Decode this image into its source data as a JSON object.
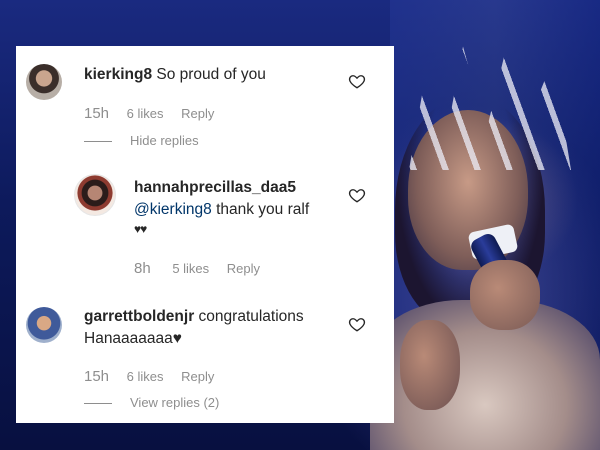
{
  "comments": [
    {
      "username": "kierking8",
      "text": "So proud of you",
      "time": "15h",
      "likes": "6 likes",
      "reply": "Reply",
      "replies_toggle": "Hide replies"
    },
    {
      "username": "hannahprecillas_daa5",
      "mention": "@kierking8",
      "text": "thank you ralf",
      "emoji": "♥♥",
      "time": "8h",
      "likes": "5 likes",
      "reply": "Reply"
    },
    {
      "username": "garrettboldenjr",
      "text": "congratulations",
      "text2": "Hanaaaaaaa♥",
      "time": "15h",
      "likes": "6 likes",
      "reply": "Reply",
      "replies_toggle": "View replies (2)"
    }
  ],
  "icons": {
    "like": "heart-outline-icon"
  },
  "colors": {
    "text": "#262626",
    "muted": "#8e8e8e",
    "mention": "#003569",
    "card_bg": "#ffffff"
  }
}
